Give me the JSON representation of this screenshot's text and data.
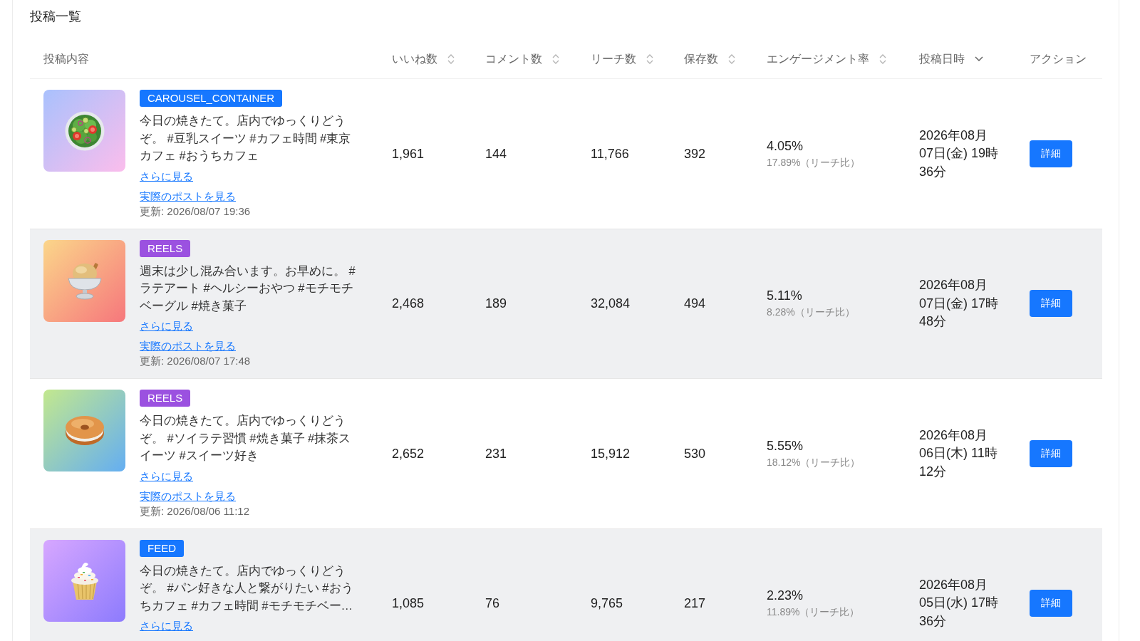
{
  "section_title": "投稿一覧",
  "table": {
    "striped": true,
    "columns": [
      {
        "label": "投稿内容",
        "sortable": false,
        "sorted": false
      },
      {
        "label": "いいね数",
        "sortable": true,
        "sorted": false
      },
      {
        "label": "コメント数",
        "sortable": true,
        "sorted": false
      },
      {
        "label": "リーチ数",
        "sortable": true,
        "sorted": false
      },
      {
        "label": "保存数",
        "sortable": true,
        "sorted": false
      },
      {
        "label": "エンゲージメント率",
        "sortable": true,
        "sorted": false
      },
      {
        "label": "投稿日時",
        "sortable": true,
        "sorted": true
      },
      {
        "label": "アクション",
        "sortable": false,
        "sorted": false
      }
    ],
    "rows": [
      {
        "media_type": {
          "label": "CAROUSEL_CONTAINER",
          "color": "#1677ff"
        },
        "caption": "今日の焼きたて。店内でゆっくりどうぞ。 #豆乳スイーツ #カフェ時間 #東京カフェ #おうちカフェ",
        "more_link": "さらに見る",
        "post_link": "実際のポストを見る",
        "updated": "更新: 2026/08/07 19:36",
        "likes": "1,961",
        "comments": "144",
        "reach": "11,766",
        "saves": "392",
        "engagement_rate": "4.05%",
        "reach_ratio": "17.89%（リーチ比）",
        "posted_at": "2026年08月07日(金) 19時36分",
        "action": "詳細"
      },
      {
        "media_type": {
          "label": "REELS",
          "color": "#9b51e0"
        },
        "caption": "週末は少し混み合います。お早めに。 #ラテアート #ヘルシーおやつ #モチモチベーグル #焼き菓子",
        "more_link": "さらに見る",
        "post_link": "実際のポストを見る",
        "updated": "更新: 2026/08/07 17:48",
        "likes": "2,468",
        "comments": "189",
        "reach": "32,084",
        "saves": "494",
        "engagement_rate": "5.11%",
        "reach_ratio": "8.28%（リーチ比）",
        "posted_at": "2026年08月07日(金) 17時48分",
        "action": "詳細"
      },
      {
        "media_type": {
          "label": "REELS",
          "color": "#9b51e0"
        },
        "caption": "今日の焼きたて。店内でゆっくりどうぞ。 #ソイラテ習慣 #焼き菓子 #抹茶スイーツ #スイーツ好き",
        "more_link": "さらに見る",
        "post_link": "実際のポストを見る",
        "updated": "更新: 2026/08/06 11:12",
        "likes": "2,652",
        "comments": "231",
        "reach": "15,912",
        "saves": "530",
        "engagement_rate": "5.55%",
        "reach_ratio": "18.12%（リーチ比）",
        "posted_at": "2026年08月06日(木) 11時12分",
        "action": "詳細"
      },
      {
        "media_type": {
          "label": "FEED",
          "color": "#1677ff"
        },
        "caption": "今日の焼きたて。店内でゆっくりどうぞ。 #パン好きな人と繋がりたい #おうちカフェ #カフェ時間 #モチモチベー…",
        "more_link": "さらに見る",
        "likes": "1,085",
        "comments": "76",
        "reach": "9,765",
        "saves": "217",
        "engagement_rate": "2.23%",
        "reach_ratio": "11.89%（リーチ比）",
        "posted_at": "2026年08月05日(水) 17時36分",
        "action": "詳細"
      }
    ]
  }
}
